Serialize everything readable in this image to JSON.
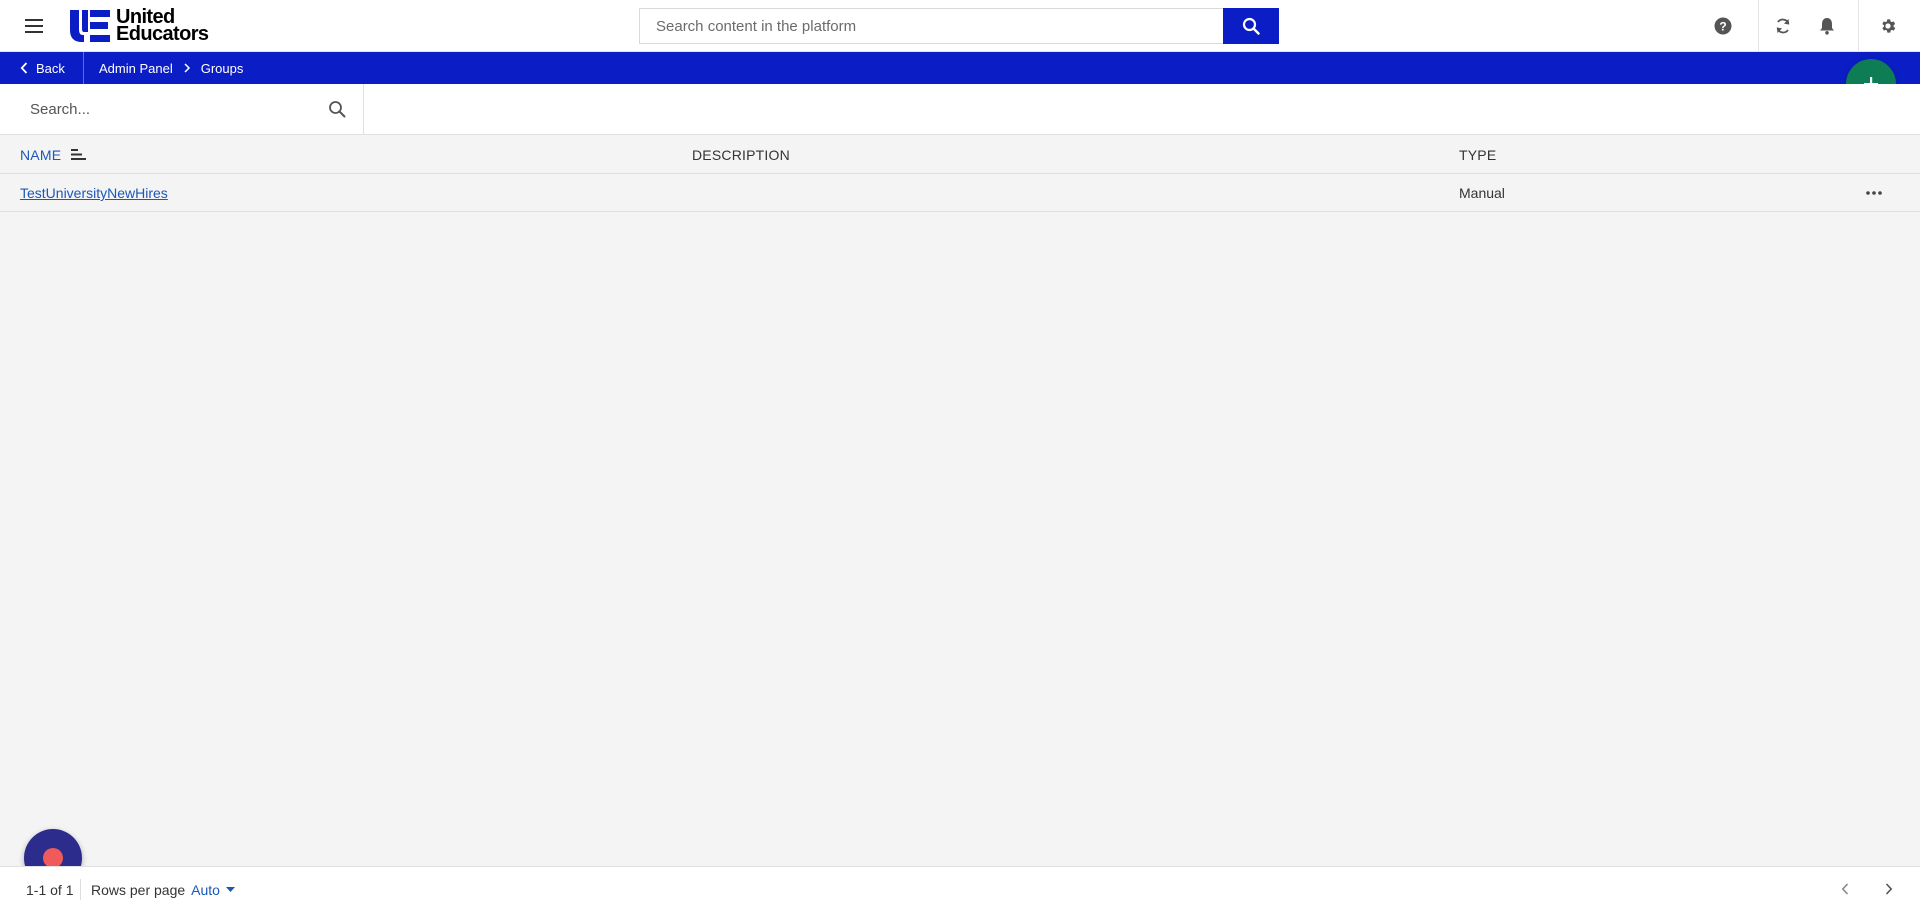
{
  "header": {
    "logo_line1": "United",
    "logo_line2": "Educators",
    "search_placeholder": "Search content in the platform",
    "icons": [
      "menu-icon",
      "search-icon",
      "help-icon",
      "sync-icon",
      "bell-icon",
      "gear-icon"
    ]
  },
  "breadcrumb": {
    "back_label": "Back",
    "items": [
      "Admin Panel",
      "Groups"
    ]
  },
  "filter": {
    "search_placeholder": "Search..."
  },
  "table": {
    "columns": [
      "NAME",
      "DESCRIPTION",
      "TYPE"
    ],
    "rows": [
      {
        "name": "TestUniversityNewHires",
        "description": "",
        "type": "Manual"
      }
    ]
  },
  "footer": {
    "range": "1-1 of 1",
    "rows_per_page_label": "Rows per page",
    "rows_per_page_value": "Auto"
  },
  "colors": {
    "primary_blue": "#0b1ec5",
    "link_blue": "#1b58b8",
    "fab_green": "#0e7d55",
    "recorder_bg": "#2c2c8c",
    "recorder_dot": "#f05a5a"
  }
}
